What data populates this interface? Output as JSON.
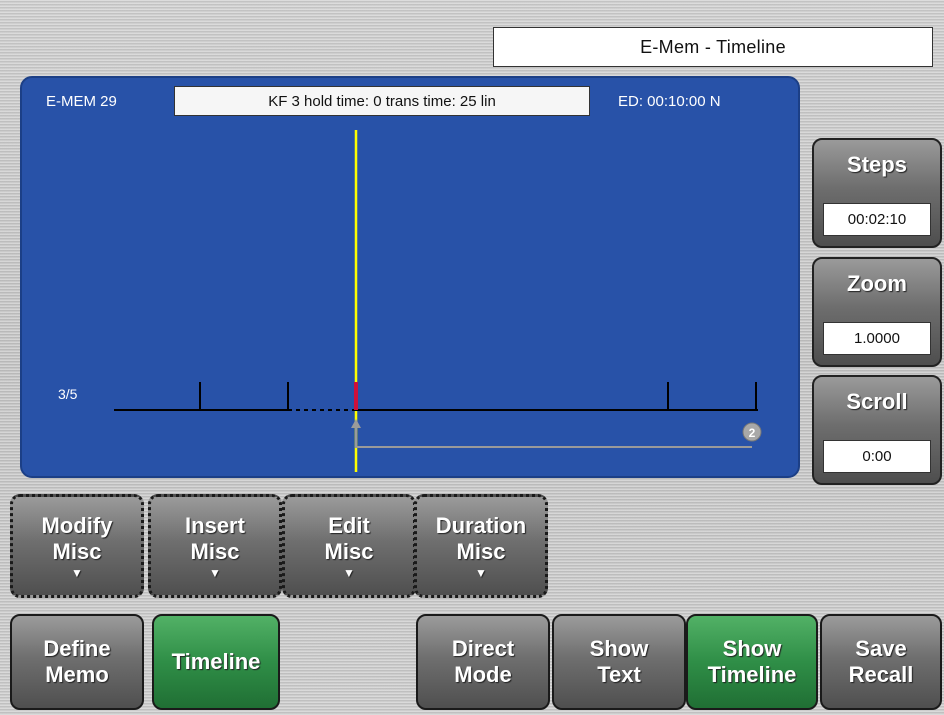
{
  "window_title": "E-Mem - Timeline",
  "timeline": {
    "emem_label": "E-MEM 29",
    "keyframe_info": "KF 3 hold time: 0 trans time: 25 lin",
    "edit_duration": "ED: 00:10:00 N",
    "track_label": "3/5",
    "marker_number": "2"
  },
  "side_controls": {
    "steps": {
      "label": "Steps",
      "value": "00:02:10"
    },
    "zoom": {
      "label": "Zoom",
      "value": "1.0000"
    },
    "scroll": {
      "label": "Scroll",
      "value": "0:00"
    }
  },
  "misc_buttons": [
    {
      "line1": "Modify",
      "line2": "Misc",
      "arrow": "▼"
    },
    {
      "line1": "Insert",
      "line2": "Misc",
      "arrow": "▼"
    },
    {
      "line1": "Edit",
      "line2": "Misc",
      "arrow": "▼"
    },
    {
      "line1": "Duration",
      "line2": "Misc",
      "arrow": "▼"
    }
  ],
  "bottom_buttons": {
    "define_memo": {
      "line1": "Define",
      "line2": "Memo"
    },
    "timeline": {
      "label": "Timeline"
    },
    "direct_mode": {
      "line1": "Direct",
      "line2": "Mode"
    },
    "show_text": {
      "line1": "Show",
      "line2": "Text"
    },
    "show_timeline": {
      "line1": "Show",
      "line2": "Timeline"
    },
    "save_recall": {
      "line1": "Save",
      "line2": "Recall"
    }
  },
  "colors": {
    "panel_bg": "#2852a8",
    "playhead": "#ffff00",
    "keyframe_marker": "#d0103a",
    "active_green": "#2f8e47"
  }
}
